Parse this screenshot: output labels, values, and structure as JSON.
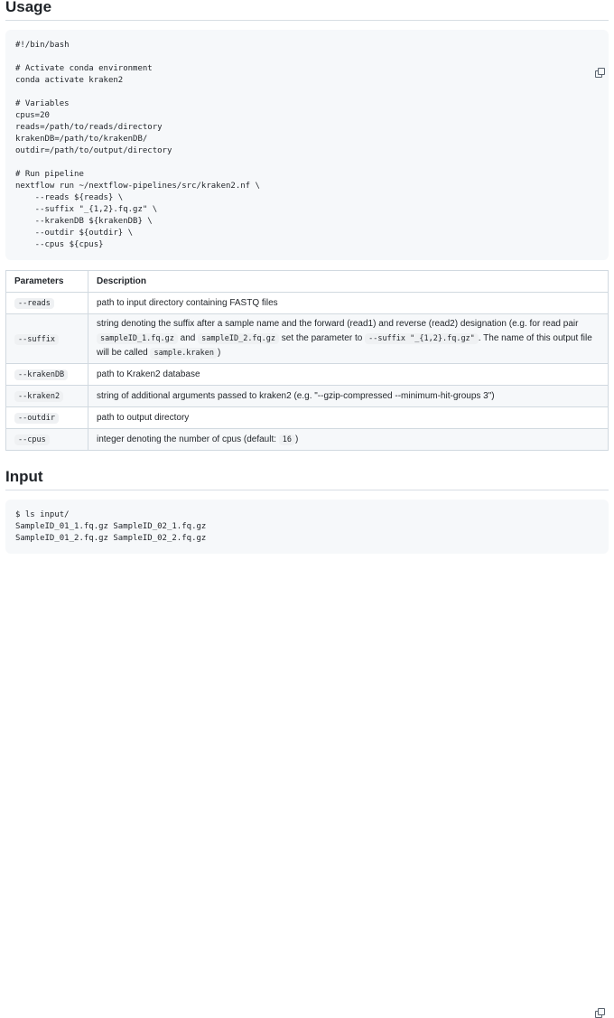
{
  "usage": {
    "heading": "Usage",
    "code": "#!/bin/bash\n\n# Activate conda environment\nconda activate kraken2\n\n# Variables\ncpus=20\nreads=/path/to/reads/directory\nkrakenDB=/path/to/krakenDB/\noutdir=/path/to/output/directory\n\n# Run pipeline\nnextflow run ~/nextflow-pipelines/src/kraken2.nf \\\n    --reads ${reads} \\\n    --suffix \"_{1,2}.fq.gz\" \\\n    --krakenDB ${krakenDB} \\\n    --outdir ${outdir} \\\n    --cpus ${cpus}",
    "copy_icon": "copy-icon"
  },
  "table": {
    "headers": [
      "Parameters",
      "Description"
    ],
    "rows": [
      {
        "param": "--reads",
        "desc": "path to input directory containing FASTQ files"
      },
      {
        "param": "--suffix",
        "desc_parts": [
          "string denoting the suffix after a sample name and the forward (read1) and reverse (read2) designation (e.g. for read pair ",
          "sampleID_1.fq.gz",
          " and ",
          "sampleID_2.fq.gz",
          " set the parameter to ",
          "--suffix \"_{1,2}.fq.gz\"",
          ". The name of this output file will be called ",
          "sample.kraken",
          ")"
        ]
      },
      {
        "param": "--krakenDB",
        "desc": "path to Kraken2 database"
      },
      {
        "param": "--kraken2",
        "desc": "string of additional arguments passed to kraken2 (e.g. \"--gzip-compressed --minimum-hit-groups 3\")"
      },
      {
        "param": "--outdir",
        "desc": "path to output directory"
      },
      {
        "param": "--cpus",
        "desc_pre": "integer denoting the number of cpus (default: ",
        "desc_code": "16",
        "desc_post": ")"
      }
    ]
  },
  "input": {
    "heading": "Input",
    "code": "$ ls input/\nSampleID_01_1.fq.gz SampleID_02_1.fq.gz\nSampleID_01_2.fq.gz SampleID_02_2.fq.gz",
    "copy_icon": "copy-icon"
  }
}
